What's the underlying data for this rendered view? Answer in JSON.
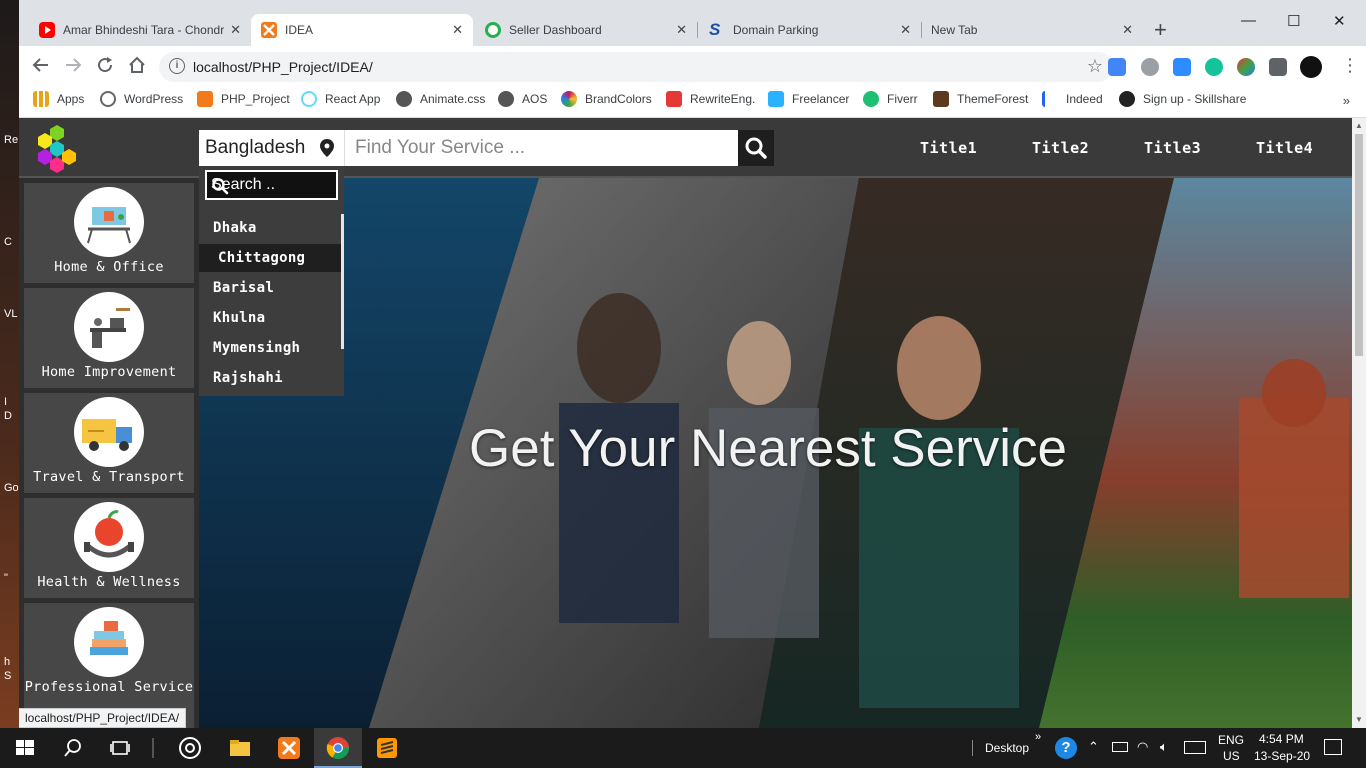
{
  "desktop": {
    "fragments": [
      "Re",
      "C",
      "VL",
      "I",
      "D",
      "Go",
      "\"",
      "h",
      "S"
    ]
  },
  "tabs": [
    {
      "title": "Amar Bhindeshi Tara - Chondr",
      "favicon": "youtube-icon",
      "color": "#ff0000",
      "active": false
    },
    {
      "title": "IDEA",
      "favicon": "xampp-icon",
      "color": "#f27a1a",
      "active": true
    },
    {
      "title": "Seller Dashboard",
      "favicon": "seller-icon",
      "color": "#22b14c",
      "active": false
    },
    {
      "title": "Domain Parking",
      "favicon": "s-logo-icon",
      "color": "#1f4fa3",
      "active": false
    },
    {
      "title": "New Tab",
      "favicon": "",
      "color": "",
      "active": false
    }
  ],
  "tab_close": "✕",
  "new_tab": "+",
  "window_controls": {
    "minimize": "—",
    "maximize": "☐",
    "close": "✕"
  },
  "address": {
    "url": "localhost/PHP_Project/IDEA/"
  },
  "bookmarks": [
    {
      "label": "Apps",
      "icon": "apps-grid-icon",
      "color": "#e8a317"
    },
    {
      "label": "WordPress",
      "icon": "globe-icon",
      "color": "#555555"
    },
    {
      "label": "PHP_Project",
      "icon": "xampp-icon",
      "color": "#f27a1a"
    },
    {
      "label": "React App",
      "icon": "react-icon",
      "color": "#61dafb"
    },
    {
      "label": "Animate.css",
      "icon": "globe-icon",
      "color": "#555555"
    },
    {
      "label": "AOS",
      "icon": "globe-icon",
      "color": "#555555"
    },
    {
      "label": "BrandColors",
      "icon": "brandcolors-icon",
      "color": "#c2185b"
    },
    {
      "label": "RewriteEng.",
      "icon": "rewrite-icon",
      "color": "#e53935"
    },
    {
      "label": "Freelancer",
      "icon": "freelancer-icon",
      "color": "#29b2fe"
    },
    {
      "label": "Fiverr",
      "icon": "fiverr-icon",
      "color": "#1dbf73"
    },
    {
      "label": "ThemeForest",
      "icon": "themeforest-icon",
      "color": "#5b3a1e"
    },
    {
      "label": "Indeed",
      "icon": "indeed-icon",
      "color": "#2164f3"
    },
    {
      "label": "Sign up - Skillshare",
      "icon": "skillshare-icon",
      "color": "#222222"
    }
  ],
  "bookmarks_more": "»",
  "site": {
    "location": "Bangladesh",
    "search_placeholder": "Find Your Service ...",
    "nav": [
      "Title1",
      "Title2",
      "Title3",
      "Title4"
    ],
    "dropdown": {
      "search_placeholder": "Search ..",
      "cities": [
        "Dhaka",
        "Chittagong",
        "Barisal",
        "Khulna",
        "Mymensingh",
        "Rajshahi"
      ],
      "selected": "Chittagong"
    },
    "categories": [
      {
        "label": "Home & Office",
        "icon": "home-office-icon"
      },
      {
        "label": "Home Improvement",
        "icon": "home-improvement-icon"
      },
      {
        "label": "Travel & Transport",
        "icon": "delivery-truck-icon"
      },
      {
        "label": "Health & Wellness",
        "icon": "health-apple-icon"
      },
      {
        "label": "Professional Service",
        "icon": "books-icon"
      }
    ],
    "hero_title": "Get Your Nearest Service"
  },
  "status_url": "localhost/PHP_Project/IDEA/",
  "taskbar": {
    "desktop_label": "Desktop",
    "expand": "»",
    "language": "ENG",
    "region": "US",
    "time": "4:54 PM",
    "date": "13-Sep-20"
  }
}
